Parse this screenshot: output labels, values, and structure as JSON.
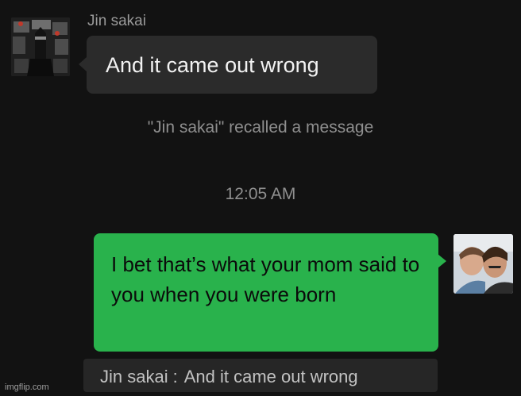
{
  "chat": {
    "incoming": {
      "sender": "Jin sakai",
      "message": "And it came out wrong"
    },
    "system_notice": "\"Jin sakai\" recalled a message",
    "timestamp": "12:05 AM",
    "outgoing": {
      "message": "I bet that’s what your mom said to you when you were born"
    },
    "quote": {
      "sender": "Jin sakai",
      "separator": ":",
      "text": "And it came out wrong"
    }
  },
  "watermark": "imgflip.com",
  "colors": {
    "background": "#121212",
    "incoming_bubble": "#2b2b2b",
    "outgoing_bubble": "#29b24c",
    "muted_text": "#8f8f8f"
  },
  "icons": {
    "left_avatar": "samurai-avatar-icon",
    "right_avatar": "user-photo-avatar-icon"
  }
}
